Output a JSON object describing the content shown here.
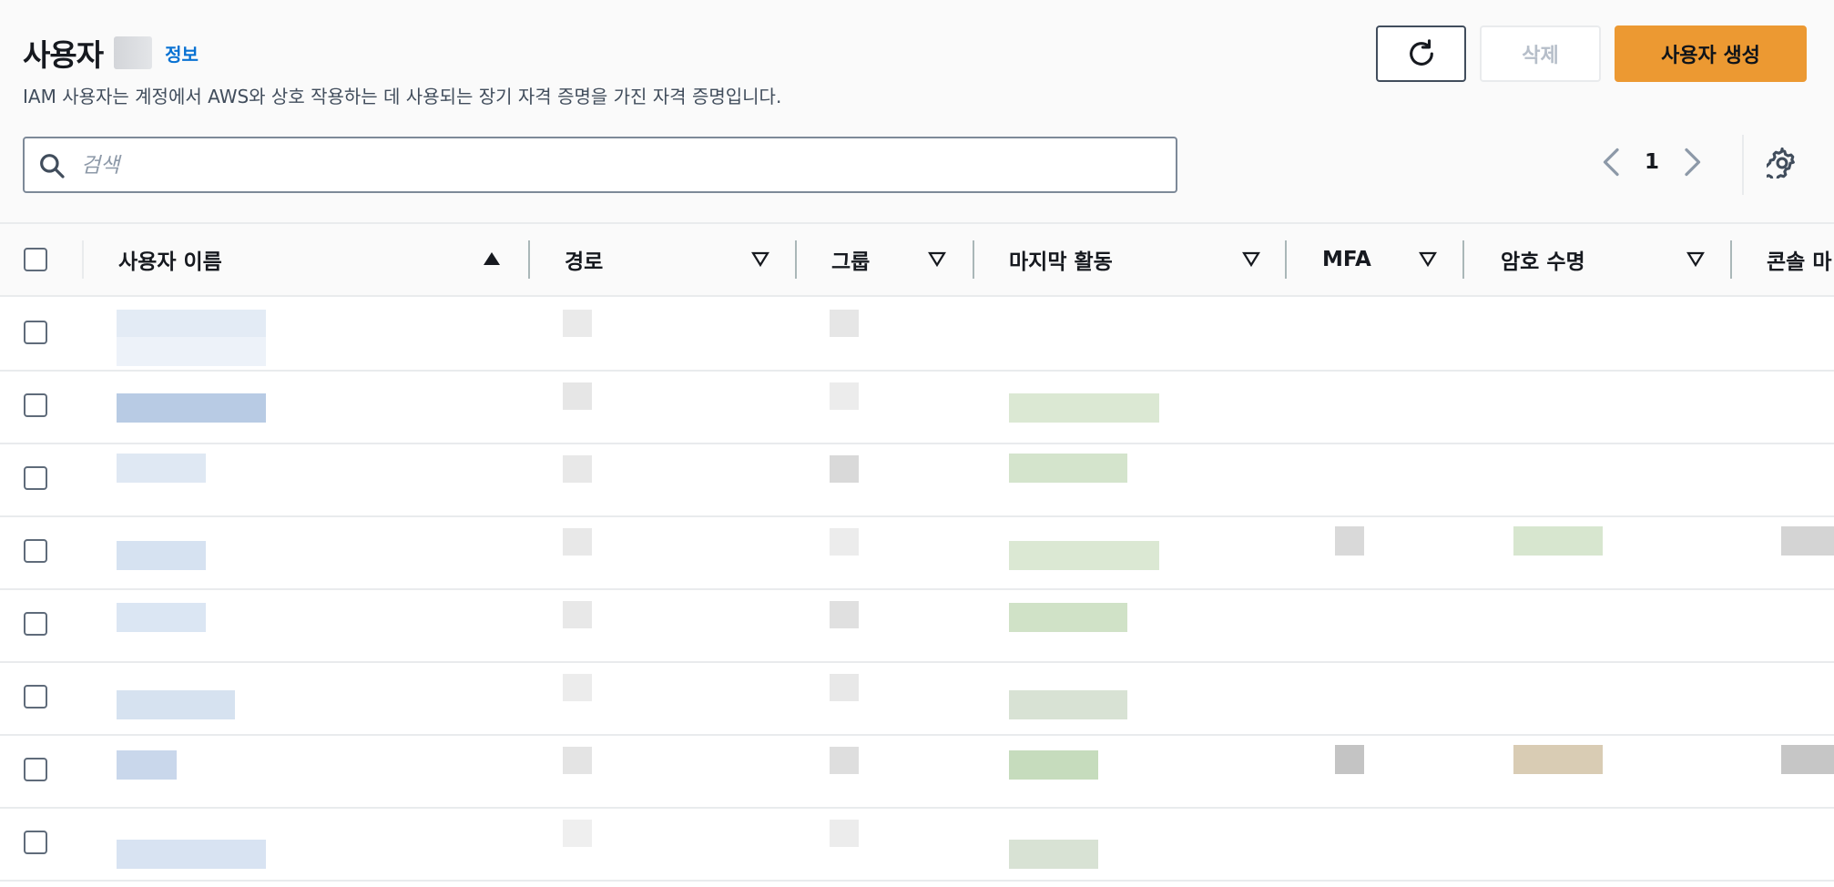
{
  "header": {
    "title": "사용자",
    "info_link": "정보",
    "description": "IAM 사용자는 계정에서 AWS와 상호 작용하는 데 사용되는 장기 자격 증명을 가진 자격 증명입니다."
  },
  "actions": {
    "delete_label": "삭제",
    "create_label": "사용자 생성"
  },
  "search": {
    "placeholder": "검색"
  },
  "pagination": {
    "current_page": "1"
  },
  "table": {
    "columns": [
      {
        "label": "사용자 이름",
        "sort": "ascending"
      },
      {
        "label": "경로",
        "sort": "none"
      },
      {
        "label": "그룹",
        "sort": "none"
      },
      {
        "label": "마지막 활동",
        "sort": "none"
      },
      {
        "label": "MFA",
        "sort": "none"
      },
      {
        "label": "암호 수명",
        "sort": "none"
      },
      {
        "label": "콘솔 마",
        "sort": "none"
      }
    ],
    "row_count": 8
  },
  "colors": {
    "primary": "#ec9932",
    "link": "#0972d3",
    "border": "#e9ebed"
  }
}
